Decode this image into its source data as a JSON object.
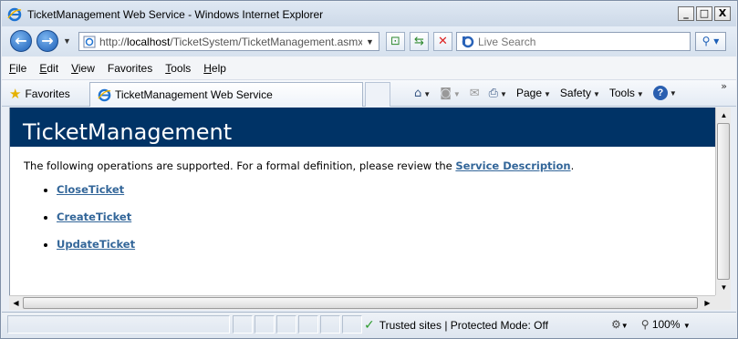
{
  "window": {
    "title": "TicketManagement Web Service - Windows Internet Explorer",
    "minimize_glyph": "_",
    "restore_glyph": "□",
    "close_glyph": "X"
  },
  "address_bar": {
    "url_scheme": "http://",
    "url_host": "localhost",
    "url_path": "/TicketSystem/TicketManagement.asmx",
    "search_placeholder": "Live Search"
  },
  "menu": {
    "items": [
      {
        "label": "File",
        "accel": "F",
        "rest": "ile"
      },
      {
        "label": "Edit",
        "accel": "E",
        "rest": "dit"
      },
      {
        "label": "View",
        "accel": "V",
        "rest": "iew"
      },
      {
        "label": "Favorites",
        "accel": "",
        "rest": "Favorites"
      },
      {
        "label": "Tools",
        "accel": "T",
        "rest": "ools"
      },
      {
        "label": "Help",
        "accel": "H",
        "rest": "elp"
      }
    ]
  },
  "favorites_bar": {
    "favorites_label": "Favorites",
    "tab_title": "TicketManagement Web Service"
  },
  "command_bar": {
    "page_label": "Page",
    "safety_label": "Safety",
    "tools_label": "Tools"
  },
  "page": {
    "heading": "TicketManagement",
    "intro_before": "The following operations are supported. For a formal definition, please review the ",
    "intro_link": "Service Description",
    "intro_after": ".",
    "operations": [
      "CloseTicket",
      "CreateTicket",
      "UpdateTicket"
    ],
    "link_color": "#336699",
    "banner_color": "#003366"
  },
  "status_bar": {
    "zone_text": "Trusted sites | Protected Mode: Off",
    "zoom": "100%"
  }
}
